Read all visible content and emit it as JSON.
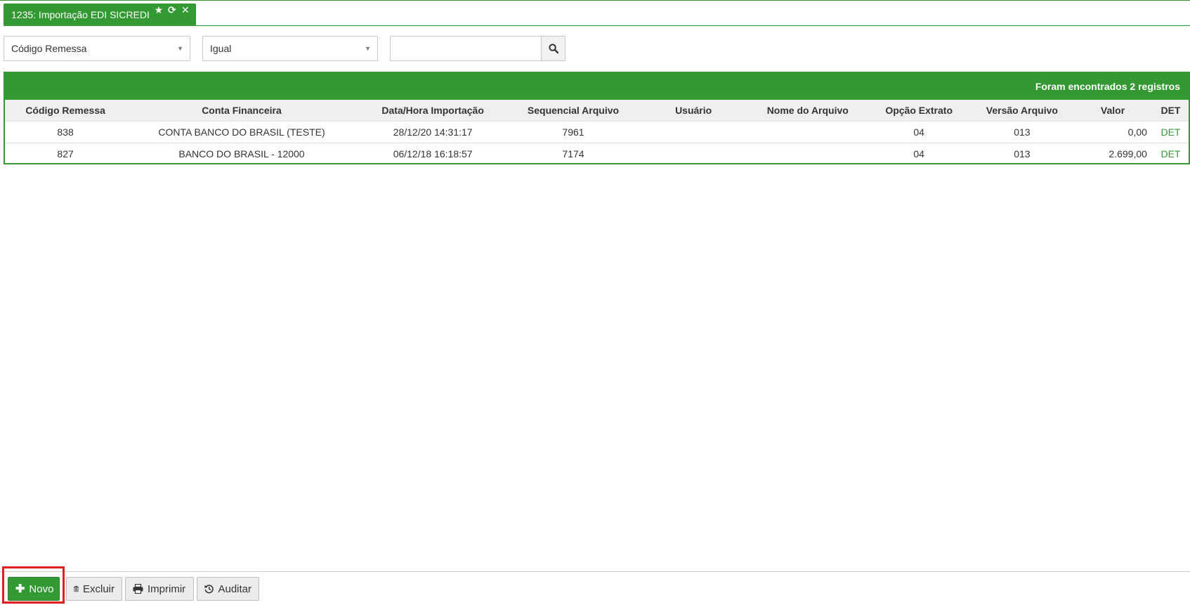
{
  "tab": {
    "title": "1235: Importação EDI SICREDI",
    "icons": [
      "star-icon",
      "refresh-icon",
      "close-icon"
    ]
  },
  "filters": {
    "field_select": "Código Remessa",
    "operator_select": "Igual",
    "search_value": ""
  },
  "grid": {
    "record_count_text": "Foram encontrados 2 registros",
    "columns": [
      "Código Remessa",
      "Conta Financeira",
      "Data/Hora Importação",
      "Sequencial Arquivo",
      "Usuário",
      "Nome do Arquivo",
      "Opção Extrato",
      "Versão Arquivo",
      "Valor",
      "DET"
    ],
    "rows": [
      [
        "838",
        "CONTA BANCO DO BRASIL (TESTE)",
        "28/12/20 14:31:17",
        "7961",
        "",
        "",
        "04",
        "013",
        "0,00",
        "DET"
      ],
      [
        "827",
        "BANCO DO BRASIL - 12000",
        "06/12/18 16:18:57",
        "7174",
        "",
        "",
        "04",
        "013",
        "2.699,00",
        "DET"
      ]
    ]
  },
  "footer": {
    "novo_label": "Novo",
    "excluir_label": "Excluir",
    "imprimir_label": "Imprimir",
    "auditar_label": "Auditar"
  },
  "colors": {
    "primary_green": "#339933",
    "highlight_red": "#e02020"
  }
}
